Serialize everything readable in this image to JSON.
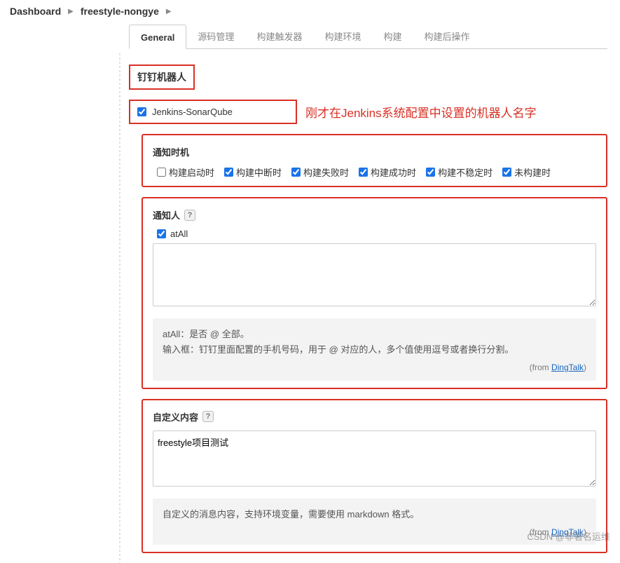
{
  "breadcrumb": {
    "items": [
      "Dashboard",
      "freestyle-nongye"
    ]
  },
  "tabs": {
    "items": [
      {
        "label": "General",
        "active": true
      },
      {
        "label": "源码管理"
      },
      {
        "label": "构建触发器"
      },
      {
        "label": "构建环境"
      },
      {
        "label": "构建"
      },
      {
        "label": "构建后操作"
      }
    ]
  },
  "section": {
    "title": "钉钉机器人"
  },
  "robot": {
    "checked": true,
    "name": "Jenkins-SonarQube",
    "annotation": "刚才在Jenkins系统配置中设置的机器人名字"
  },
  "notify_timing": {
    "title": "通知时机",
    "items": [
      {
        "label": "构建启动时",
        "checked": false
      },
      {
        "label": "构建中断时",
        "checked": true
      },
      {
        "label": "构建失败时",
        "checked": true
      },
      {
        "label": "构建成功时",
        "checked": true
      },
      {
        "label": "构建不稳定时",
        "checked": true
      },
      {
        "label": "未构建时",
        "checked": true
      }
    ]
  },
  "notify_who": {
    "title": "通知人",
    "atall_label": "atAll",
    "atall_checked": true,
    "textarea_value": "",
    "help_line1": "atAll：是否 @ 全部。",
    "help_line2": "输入框：钉钉里面配置的手机号码，用于 @ 对应的人，多个值使用逗号或者换行分割。",
    "from_text": "(from ",
    "from_link": "DingTalk",
    "from_close": ")"
  },
  "custom_content": {
    "title": "自定义内容",
    "textarea_value": "freestyle项目测试",
    "help_line": "自定义的消息内容，支持环境变量，需要使用 markdown 格式。",
    "from_text": "(from ",
    "from_link": "DingTalk",
    "from_close": ")"
  },
  "watermark": "CSDN @非著名运维",
  "icons": {
    "help": "?"
  }
}
